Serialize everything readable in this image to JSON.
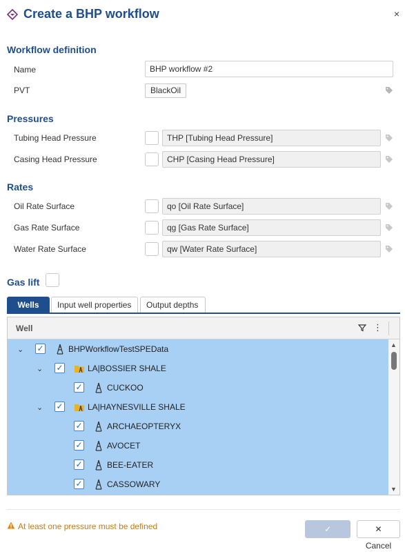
{
  "header": {
    "title": "Create a BHP workflow",
    "close_label": "×"
  },
  "workflow_definition": {
    "title": "Workflow definition",
    "name_label": "Name",
    "name_value": "BHP workflow #2",
    "pvt_label": "PVT",
    "pvt_value": "BlackOil"
  },
  "pressures": {
    "title": "Pressures",
    "items": [
      {
        "label": "Tubing Head Pressure",
        "value": "THP [Tubing Head Pressure]"
      },
      {
        "label": "Casing Head Pressure",
        "value": "CHP [Casing Head Pressure]"
      }
    ]
  },
  "rates": {
    "title": "Rates",
    "items": [
      {
        "label": "Oil Rate Surface",
        "value": "qo [Oil Rate Surface]"
      },
      {
        "label": "Gas Rate Surface",
        "value": "qg [Gas Rate Surface]"
      },
      {
        "label": "Water Rate Surface",
        "value": "qw [Water Rate Surface]"
      }
    ]
  },
  "gas_lift": {
    "label": "Gas lift"
  },
  "tabs": [
    "Wells",
    "Input well properties",
    "Output depths"
  ],
  "grid": {
    "column": "Well",
    "rows": [
      {
        "label": "BHPWorkflowTestSPEData",
        "type": "well",
        "checked": true,
        "expanded": true
      },
      {
        "label": "LA|BOSSIER SHALE",
        "type": "folder",
        "checked": true,
        "expanded": true
      },
      {
        "label": "CUCKOO",
        "type": "well",
        "checked": true
      },
      {
        "label": "LA|HAYNESVILLE SHALE",
        "type": "folder",
        "checked": true,
        "expanded": true
      },
      {
        "label": "ARCHAEOPTERYX",
        "type": "well",
        "checked": true
      },
      {
        "label": "AVOCET",
        "type": "well",
        "checked": true
      },
      {
        "label": "BEE-EATER",
        "type": "well",
        "checked": true
      },
      {
        "label": "CASSOWARY",
        "type": "well",
        "checked": true
      }
    ]
  },
  "footer": {
    "warning": "At least one pressure must be defined",
    "create_label": "Create",
    "cancel_label": "Cancel"
  },
  "colors": {
    "accent": "#1f4e8c",
    "selection": "#a8d0f5",
    "warning": "#c77b12"
  }
}
